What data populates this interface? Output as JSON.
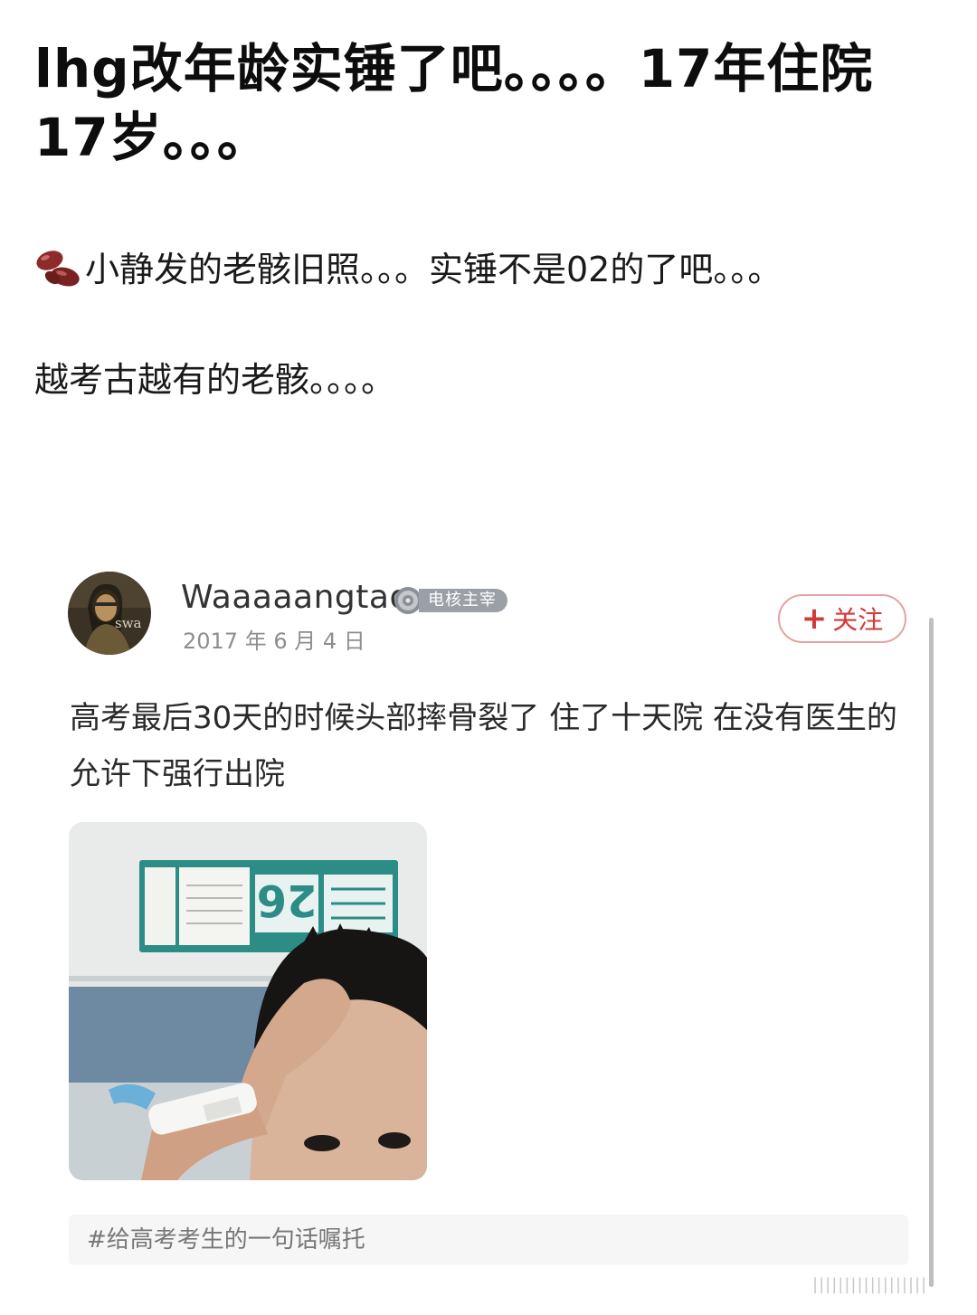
{
  "post": {
    "title": "lhg改年龄实锤了吧。。。。17年住院17岁。。。",
    "paragraph_1": "小静发的老骸旧照。。。实锤不是02的了吧。。。",
    "paragraph_2": "越考古越有的老骸。。。。"
  },
  "quoted_post": {
    "author_name": "Waaaaangtao",
    "badge_label": "电核主宰",
    "date": "2017 年 6 月 4 日",
    "follow_plus": "+",
    "follow_label": "关注",
    "text": "高考最后30天的时候头部摔骨裂了 住了十天院 在没有医生的允许下强行出院",
    "topic_tag": "#给高考考生的一句话嘱托",
    "photo_room_number": "26"
  },
  "watermark": "||||||||||||||||||",
  "colors": {
    "follow_red": "#d23a3a",
    "muted_gray": "#8e8e8e",
    "tag_background": "#f6f6f6"
  },
  "icons": {
    "bean": "kidney-bean-icon",
    "badge": "disc-badge-icon"
  }
}
